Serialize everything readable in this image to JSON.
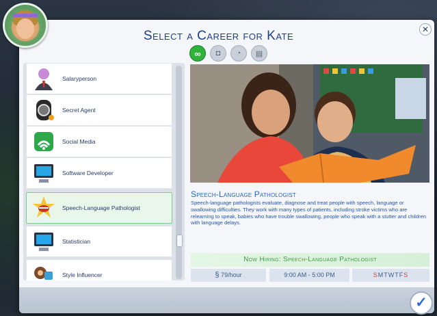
{
  "dialog": {
    "title": "Select a Career for Kate",
    "close_label": "✕",
    "confirm_label": "✓"
  },
  "filters": [
    {
      "icon": "infinity-icon",
      "glyph": "∞",
      "active": true
    },
    {
      "icon": "camera-icon",
      "glyph": "◘",
      "active": false
    },
    {
      "icon": "clock-icon",
      "glyph": "◔",
      "active": false
    },
    {
      "icon": "folders-icon",
      "glyph": "▤",
      "active": false
    }
  ],
  "careers": [
    {
      "label": "Salaryperson",
      "icon": "salaryperson-icon"
    },
    {
      "label": "Secret Agent",
      "icon": "secret-agent-icon"
    },
    {
      "label": "Social Media",
      "icon": "social-media-icon"
    },
    {
      "label": "Software Developer",
      "icon": "software-developer-icon"
    },
    {
      "label": "Speech-Language Pathologist",
      "icon": "speech-language-icon"
    },
    {
      "label": "Statistician",
      "icon": "statistician-icon"
    },
    {
      "label": "Style Influencer",
      "icon": "style-influencer-icon"
    }
  ],
  "selected": {
    "title": "Speech-Language Pathologist",
    "description": "Speech-language pathologists evaluate, diagnose and treat people with speech, language or swallowing difficulties. They work with many types of patients, including stroke victims who are relearning to speak, babies who have trouble swallowing, people who speak with a stutter and children with language delays.",
    "hiring": "Now Hiring: Speech-Language Pathologist",
    "pay_symbol": "§",
    "pay": "79/hour",
    "hours": "9:00 AM - 5:00 PM",
    "days": [
      {
        "letter": "S",
        "works": true
      },
      {
        "letter": "M",
        "works": false
      },
      {
        "letter": "T",
        "works": false
      },
      {
        "letter": "W",
        "works": false
      },
      {
        "letter": "T",
        "works": false
      },
      {
        "letter": "F",
        "works": false
      },
      {
        "letter": "S",
        "works": true
      }
    ]
  },
  "colors": {
    "title_blue": "#1d3e8a",
    "accent_green": "#2fb33a",
    "work_day_red": "#d23a3a"
  }
}
